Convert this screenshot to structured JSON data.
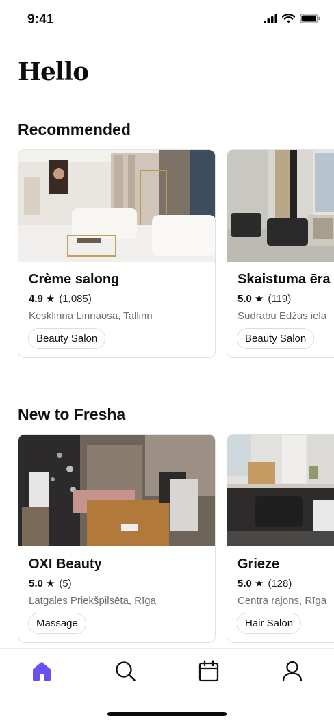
{
  "status_bar": {
    "time": "9:41",
    "icons": [
      "signal-icon",
      "wifi-icon",
      "battery-icon"
    ]
  },
  "greeting": "Hello",
  "sections": [
    {
      "title": "Recommended",
      "cards": [
        {
          "name": "Crème salong",
          "rating": "4.9",
          "reviews": "(1,085)",
          "location": "Kesklinna Linnaosa, Tallinn",
          "tag": "Beauty Salon"
        },
        {
          "name": "Skaistuma ēra",
          "rating": "5.0",
          "reviews": "(119)",
          "location": "Sudrabu Edžus iela",
          "tag": "Beauty Salon"
        }
      ]
    },
    {
      "title": "New to Fresha",
      "cards": [
        {
          "name": "OXI Beauty",
          "rating": "5.0",
          "reviews": "(5)",
          "location": "Latgales Priekšpilsēta, Rīga",
          "tag": "Massage"
        },
        {
          "name": "Grieze",
          "rating": "5.0",
          "reviews": "(128)",
          "location": "Centra rajons, Rīga",
          "tag": "Hair Salon"
        }
      ]
    }
  ],
  "tabbar": {
    "items": [
      {
        "icon": "home-icon",
        "active": true
      },
      {
        "icon": "search-icon",
        "active": false
      },
      {
        "icon": "calendar-icon",
        "active": false
      },
      {
        "icon": "profile-icon",
        "active": false
      }
    ]
  },
  "colors": {
    "accent": "#6950f3",
    "text": "#101010",
    "secondary_text": "#6f6f75",
    "border": "#e1e1e4"
  }
}
